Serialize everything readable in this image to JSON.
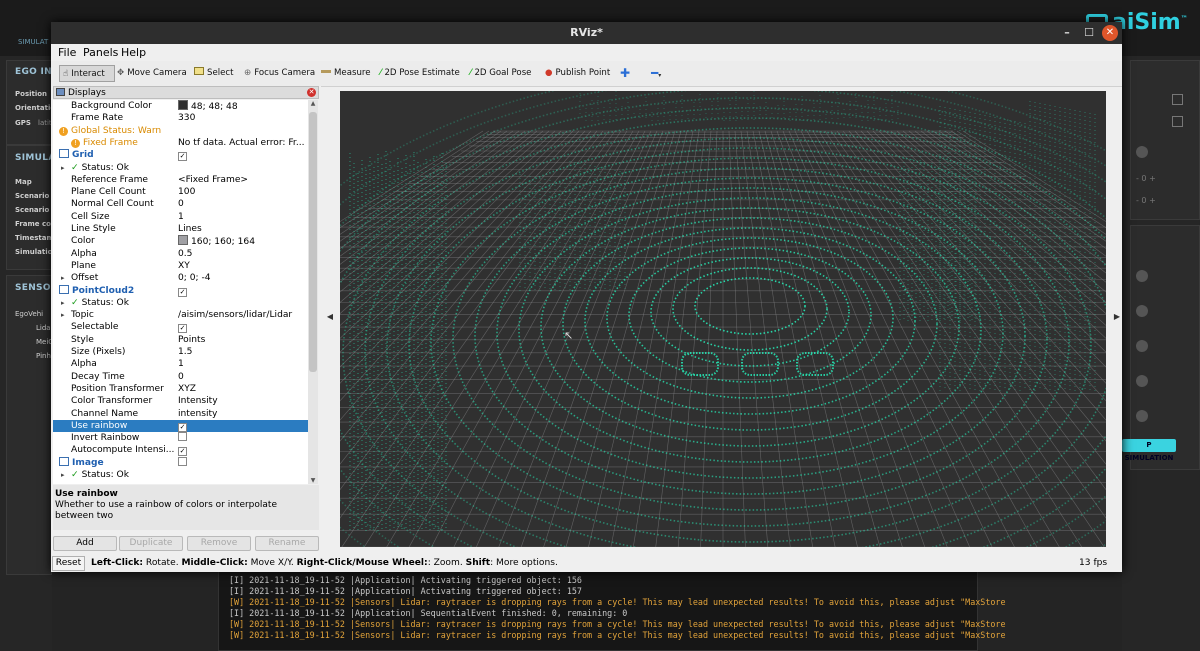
{
  "background_app": {
    "sim_tab": "SIMULAT",
    "sections": {
      "ego": "EGO INF",
      "simulation": "SIMULAT",
      "sensor": "SENSOR"
    },
    "ego_labels": [
      "Position",
      "Orientation",
      "GPS"
    ],
    "gps_prefix": "latit",
    "sim_labels": [
      "Map",
      "Scenario ID",
      "Scenario tit",
      "Frame cour",
      "Timestamp",
      "Simulation"
    ],
    "sensor_items": [
      "EgoVehi",
      "Lidar",
      "MeiO",
      "Pinho"
    ],
    "logo_text": "aiSim",
    "logo_tm": "™",
    "stop_button": "P SIMULATION",
    "steppers": [
      "- 0 +",
      "- 0 +"
    ],
    "console_lines": [
      {
        "level": "info",
        "text": "[I] 2021-11-18_19-11-52     |Application| Activating triggered object: 156"
      },
      {
        "level": "info",
        "text": "[I] 2021-11-18_19-11-52     |Application| Activating triggered object: 157"
      },
      {
        "level": "warn",
        "text": "[W] 2021-11-18_19-11-52     |Sensors| Lidar: raytracer is dropping rays from a cycle! This may lead unexpected results! To avoid this, please adjust \"MaxStore"
      },
      {
        "level": "info",
        "text": "[I] 2021-11-18_19-11-52     |Application| SequentialEvent finished: 0, remaining: 0"
      },
      {
        "level": "warn",
        "text": "[W] 2021-11-18_19-11-52     |Sensors| Lidar: raytracer is dropping rays from a cycle! This may lead unexpected results! To avoid this, please adjust \"MaxStore"
      },
      {
        "level": "warn",
        "text": "[W] 2021-11-18_19-11-52     |Sensors| Lidar: raytracer is dropping rays from a cycle! This may lead unexpected results! To avoid this, please adjust \"MaxStore"
      }
    ]
  },
  "window": {
    "title": "RViz*",
    "close_glyph": "✕",
    "min_glyph": "–",
    "max_glyph": "☐"
  },
  "menu": [
    "File",
    "Panels",
    "Help"
  ],
  "toolbar": [
    "Interact",
    "Move Camera",
    "Select",
    "Focus Camera",
    "Measure",
    "2D Pose Estimate",
    "2D Goal Pose",
    "Publish Point"
  ],
  "displays": {
    "header": "Displays",
    "rows": [
      {
        "label": "Background Color",
        "value": "48; 48; 48",
        "swatch": "#303030"
      },
      {
        "label": "Frame Rate",
        "value": "330"
      },
      {
        "label": "Global Status: Warn",
        "value": "",
        "status": "warn"
      },
      {
        "label": "Fixed Frame",
        "value": "No tf data.  Actual error: Fr...",
        "status": "warn"
      },
      {
        "label": "Grid",
        "value": "",
        "check": true
      },
      {
        "label": "Status: Ok",
        "value": ""
      },
      {
        "label": "Reference Frame",
        "value": "<Fixed Frame>"
      },
      {
        "label": "Plane Cell Count",
        "value": "100"
      },
      {
        "label": "Normal Cell Count",
        "value": "0"
      },
      {
        "label": "Cell Size",
        "value": "1"
      },
      {
        "label": "Line Style",
        "value": "Lines"
      },
      {
        "label": "Color",
        "value": "160; 160; 164",
        "swatch": "#a0a0a4"
      },
      {
        "label": "Alpha",
        "value": "0.5"
      },
      {
        "label": "Plane",
        "value": "XY"
      },
      {
        "label": "Offset",
        "value": "0; 0; -4"
      },
      {
        "label": "PointCloud2",
        "value": "",
        "check": true
      },
      {
        "label": "Status: Ok",
        "value": ""
      },
      {
        "label": "Topic",
        "value": "/aisim/sensors/lidar/Lidar"
      },
      {
        "label": "Selectable",
        "value": "",
        "check": true
      },
      {
        "label": "Style",
        "value": "Points"
      },
      {
        "label": "Size (Pixels)",
        "value": "1.5"
      },
      {
        "label": "Alpha",
        "value": "1"
      },
      {
        "label": "Decay Time",
        "value": "0"
      },
      {
        "label": "Position Transformer",
        "value": "XYZ"
      },
      {
        "label": "Color Transformer",
        "value": "Intensity"
      },
      {
        "label": "Channel Name",
        "value": "intensity"
      },
      {
        "label": "Use rainbow",
        "value": "",
        "check": true,
        "selected": true
      },
      {
        "label": "Invert Rainbow",
        "value": "",
        "check": false
      },
      {
        "label": "Autocompute Intensi...",
        "value": "",
        "check": true
      },
      {
        "label": "Image",
        "value": "",
        "check": false
      },
      {
        "label": "Status: Ok",
        "value": ""
      }
    ],
    "desc_title": "Use rainbow",
    "desc_text": "Whether to use a rainbow of colors or interpolate between two",
    "buttons": [
      "Add",
      "Duplicate",
      "Remove",
      "Rename"
    ]
  },
  "status_bar": {
    "reset": "Reset",
    "hint_b1": "Left-Click:",
    "hint_t1": " Rotate. ",
    "hint_b2": "Middle-Click:",
    "hint_t2": " Move X/Y. ",
    "hint_b3": "Right-Click/Mouse Wheel:",
    "hint_t3": ": Zoom. ",
    "hint_b4": "Shift",
    "hint_t4": ": More options.",
    "fps": "13 fps"
  },
  "colors": {
    "accent": "#2fd0e0",
    "lidar": "#27e0b0",
    "selection": "#2b7cc1",
    "warn": "#e2a33a"
  }
}
